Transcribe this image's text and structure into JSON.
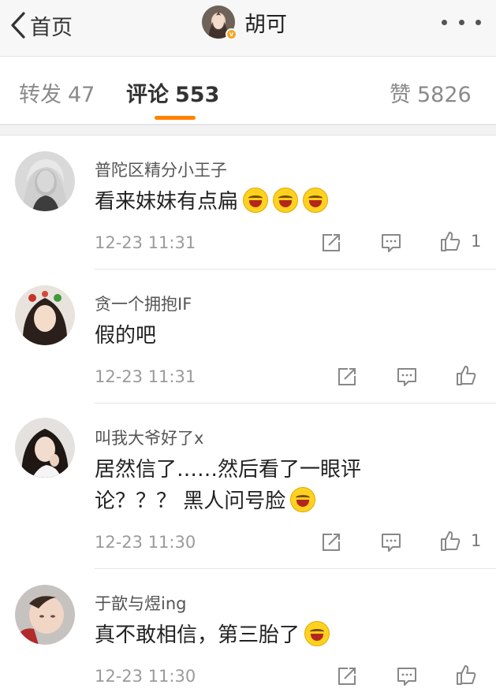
{
  "nav": {
    "back_label": "首页",
    "profile_name": "胡可"
  },
  "tabs": [
    {
      "label": "转发",
      "count": "47"
    },
    {
      "label": "评论",
      "count": "553"
    },
    {
      "label": "赞",
      "count": "5826"
    }
  ],
  "active_tab": "评论",
  "accent_color": "#ff8200",
  "comments": [
    {
      "username": "普陀区精分小王子",
      "text": "看来妹妹有点扁",
      "emojis": [
        "laughing-tears-emoji",
        "laughing-tears-emoji",
        "laughing-tears-emoji"
      ],
      "time": "12-23 11:31",
      "likes": "1"
    },
    {
      "username": "贪一个拥抱IF",
      "text": "假的吧",
      "emojis": [],
      "time": "12-23 11:31",
      "likes": ""
    },
    {
      "username": "叫我大爷好了x",
      "text_line1": "居然信了……然后看了一眼评",
      "text_line2": "论？？？ 黑人问号脸",
      "emojis": [
        "crying-face-emoji"
      ],
      "time": "12-23 11:30",
      "likes": "1"
    },
    {
      "username": "于歆与煜ing",
      "text": "真不敢相信，第三胎了",
      "emojis": [
        "shocked-face-emoji"
      ],
      "time": "12-23 11:30",
      "likes": ""
    }
  ],
  "icons": {
    "repost": "repost-icon",
    "comment": "comment-icon",
    "like": "thumbs-up-icon",
    "more": "more-dots-icon",
    "back": "chevron-left-icon"
  }
}
